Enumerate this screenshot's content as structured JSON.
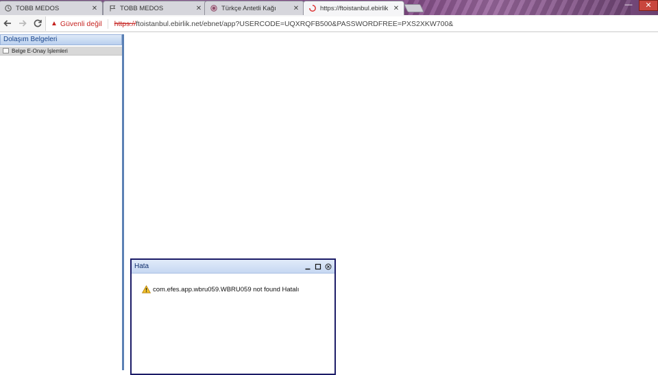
{
  "tabs": [
    {
      "title": "TOBB MEDOS",
      "icon": "tobb-logo-icon"
    },
    {
      "title": "TOBB MEDOS",
      "icon": "flag-icon"
    },
    {
      "title": "Türkçe Antetli Kağı",
      "icon": "seal-icon"
    },
    {
      "title": "https://ftoistanbul.ebirlik",
      "icon": "loading-spinner-icon"
    }
  ],
  "toolbar": {
    "security_label": "Güvenli değil",
    "url_scheme": "https://",
    "url_rest": "ftoistanbul.ebirlik.net/ebnet/app?USERCODE=UQXRQFB500&PASSWORDFREE=PXS2XKW700&"
  },
  "sidebar": {
    "title": "Dolaşım Belgeleri",
    "items": [
      {
        "label": "Belge E-Onay İşlemleri"
      }
    ]
  },
  "error_window": {
    "title": "Hata",
    "message": "com.efes.app.wbru059.WBRU059 not found Hatalı"
  },
  "colors": {
    "accent": "#5a80b4",
    "title_text": "#15428b",
    "insecure_red": "#c5221f",
    "error_border": "#1a1a66"
  }
}
